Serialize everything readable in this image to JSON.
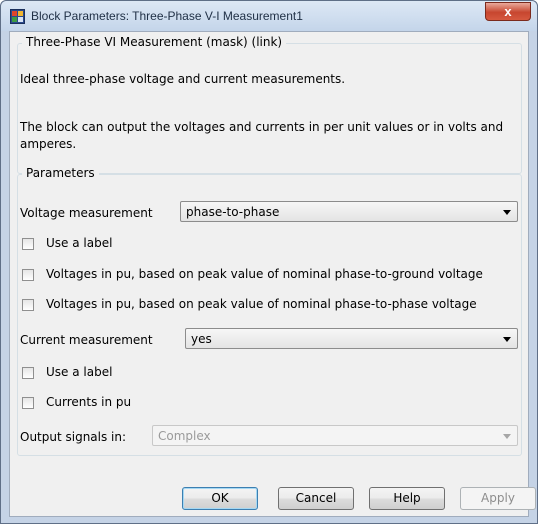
{
  "window": {
    "title": "Block Parameters: Three-Phase V-I Measurement1",
    "close_glyph": "x",
    "app_icon": "simulink-block-icon"
  },
  "description": {
    "group_title": "Three-Phase VI Measurement (mask) (link)",
    "line1": "Ideal three-phase voltage and current measurements.",
    "line2": "The block can output the voltages and currents in per unit values or in volts and amperes."
  },
  "parameters": {
    "group_title": "Parameters",
    "voltage_measurement": {
      "label": "Voltage measurement",
      "value": "phase-to-phase"
    },
    "use_label_1": {
      "label": "Use a label",
      "checked": false
    },
    "voltages_pu_pg": {
      "label": "Voltages in pu,  based on peak value of nominal phase-to-ground voltage",
      "checked": false
    },
    "voltages_pu_pp": {
      "label": "Voltages in pu,  based on peak value of nominal phase-to-phase  voltage",
      "checked": false
    },
    "current_measurement": {
      "label": "Current measurement",
      "value": "yes"
    },
    "use_label_2": {
      "label": "Use a label",
      "checked": false
    },
    "currents_pu": {
      "label": "Currents in pu",
      "checked": false
    },
    "output_signals": {
      "label": "Output signals in:",
      "value": "Complex",
      "enabled": false
    }
  },
  "buttons": {
    "ok": "OK",
    "cancel": "Cancel",
    "help": "Help",
    "apply": "Apply"
  }
}
